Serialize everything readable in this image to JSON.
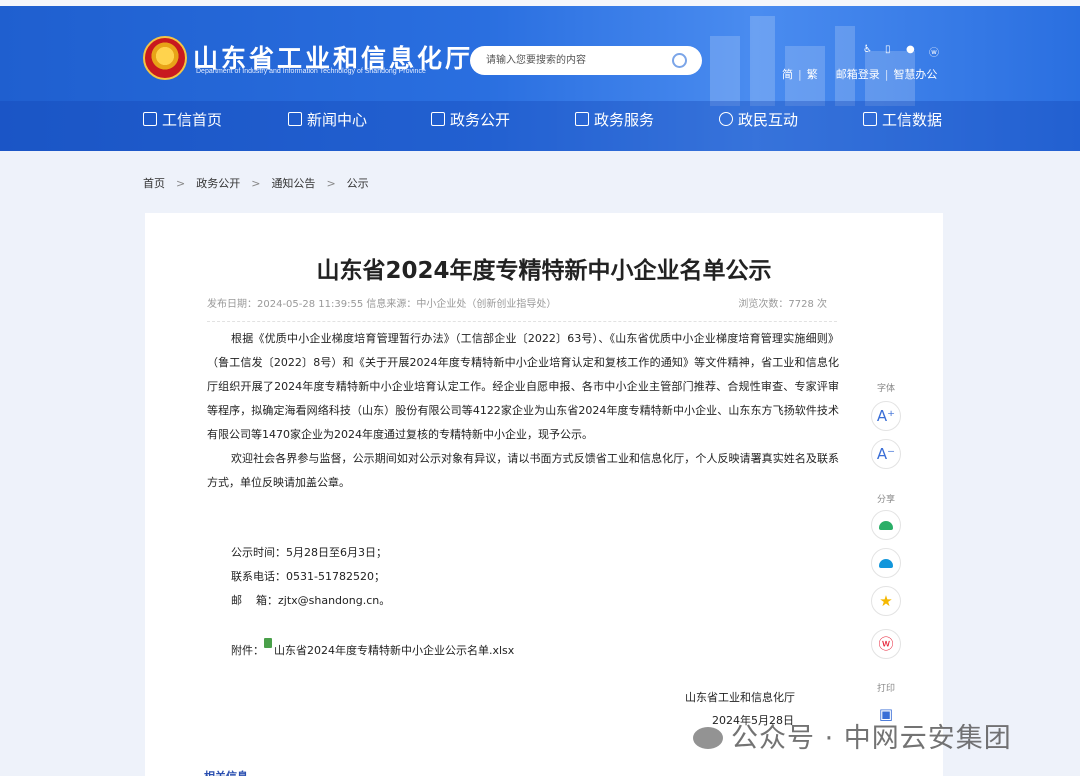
{
  "header": {
    "site_title": "山东省工业和信息化厅",
    "site_subtitle": "Department of Industry and Information Technology of Shandong Province",
    "search_placeholder": "请输入您要搜索的内容",
    "top_links": [
      "简",
      "繁",
      "邮箱登录",
      "智慧办公"
    ]
  },
  "nav": {
    "items": [
      "工信首页",
      "新闻中心",
      "政务公开",
      "政务服务",
      "政民互动",
      "工信数据"
    ]
  },
  "breadcrumb": [
    "首页",
    "政务公开",
    "通知公告",
    "公示"
  ],
  "article": {
    "title": "山东省2024年度专精特新中小企业名单公示",
    "meta_left": "发布日期：2024-05-28 11:39:55    信息来源：中小企业处（创新创业指导处）",
    "meta_right": "浏览次数：7728    次",
    "paragraphs": [
      "根据《优质中小企业梯度培育管理暂行办法》（工信部企业〔2022〕63号）、《山东省优质中小企业梯度培育管理实施细则》（鲁工信发〔2022〕8号）和《关于开展2024年度专精特新中小企业培育认定和复核工作的通知》等文件精神，省工业和信息化厅组织开展了2024年度专精特新中小企业培育认定工作。经企业自愿申报、各市中小企业主管部门推荐、合规性审查、专家评审等程序，拟确定海看网络科技（山东）股份有限公司等4122家企业为山东省2024年度专精特新中小企业、山东东方飞扬软件技术有限公司等1470家企业为2024年度通过复核的专精特新中小企业，现予公示。",
      "欢迎社会各界参与监督，公示期间如对公示对象有异议，请以书面方式反馈省工业和信息化厅，个人反映请署真实姓名及联系方式，单位反映请加盖公章。"
    ],
    "notice_period": "公示时间：5月28日至6月3日；",
    "phone": "联系电话：0531-51782520；",
    "email": "邮    箱：zjtx@shandong.cn。",
    "attachment_label": "附件：",
    "attachment_file": "山东省2024年度专精特新中小企业公示名单.xlsx",
    "signature_org": "山东省工业和信息化厅",
    "signature_date": "2024年5月28日"
  },
  "side_tools": {
    "font_label": "字体",
    "font_increase": "A⁺",
    "font_decrease": "A⁻",
    "share_label": "分享",
    "print_label": "打印"
  },
  "watermark": "公众号 · 中网云安集团",
  "related": "相关信息",
  "colors": {
    "header_blue": "#2a6fe0",
    "weibo_red": "#e6162d",
    "wechat_green": "#2aae67",
    "qzone_yellow": "#f5b800",
    "qq_blue": "#1296db"
  }
}
